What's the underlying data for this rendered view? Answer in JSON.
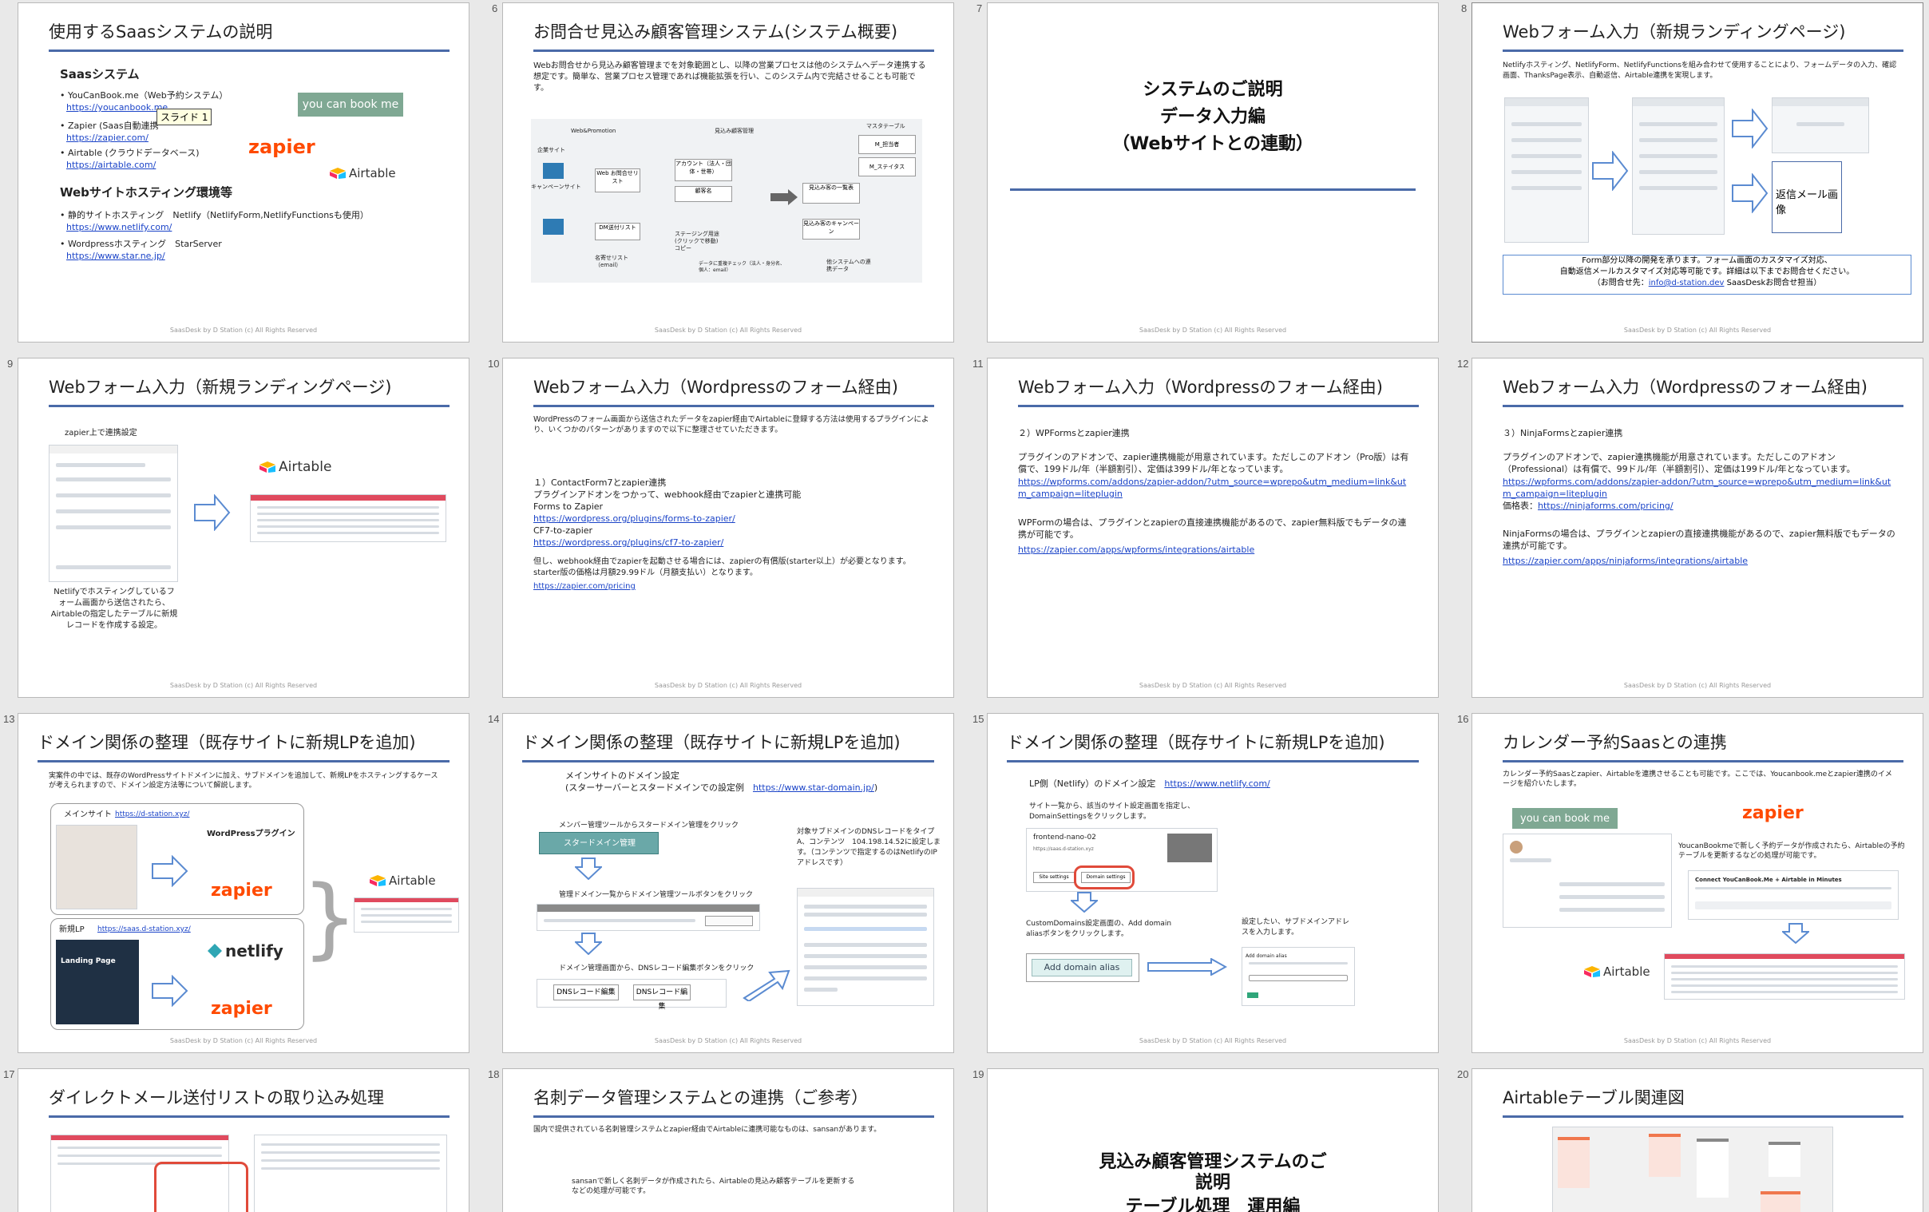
{
  "footer": "SaasDesk by D Station (c) All Rights Reserved",
  "colors": {
    "accent": "#4a6aa8",
    "zapier": "#ff4a00",
    "link": "#1b44c8"
  },
  "slides": {
    "s5": {
      "title": "使用するSaasシステムの説明",
      "h1": "Saasシステム",
      "b1": "YouCanBook.me（Web予約システム）",
      "l1": "https://youcanbook.me",
      "b2": "Zapier (Saas自動連携",
      "l2": "https://zapier.com/",
      "b3": "Airtable (クラウドデータベース)",
      "l3": "https://airtable.com/",
      "h2": "Webサイトホスティング環境等",
      "b4": "静的サイトホスティング　Netlify（NetlifyForm,NetlifyFunctionsも使用）",
      "l4": "https://www.netlify.com/",
      "b5": "Wordpressホスティング　StarServer",
      "l5": "https://www.star.ne.jp/",
      "tooltip": "スライド 1",
      "ybm": "you can book me",
      "zapier": "zapier",
      "airtable": "Airtable"
    },
    "s6": {
      "num": "6",
      "title": "お問合せ見込み顧客管理システム(システム概要)",
      "text": "Webお問合せから見込み顧客管理までを対象範囲とし、以降の営業プロセスは他のシステムへデータ連携する想定です。簡単な、営業プロセス管理であれば機能拡張を行い、このシステム内で完結させることも可能です。",
      "d_web": "Web&Promotion",
      "d_crm": "見込み顧客管理",
      "d_master": "マスタテーブル",
      "d_company": "企業サイト",
      "d_campaign": "キャンペーンサイト",
      "d_form": "Web お問合せリスト",
      "d_account": "アカウント（法人・団体・世帯）",
      "d_contact": "顧客名",
      "d_dm": "DM送付リスト",
      "d_m1": "M_担当者",
      "d_m2": "M_ステイタス",
      "d_lead": "見込み客の一覧表",
      "d_campaign2": "見込み客のキャンペーン",
      "d_list": "名寄せリスト（email）",
      "d_status": "ステージング用途(クリックで移動)コピー",
      "d_check": "データに重複チェック（法人・身分名、個人：email）",
      "d_other": "他システムへの連携データ"
    },
    "s7": {
      "num": "7",
      "line1": "システムのご説明",
      "line2": "データ入力編",
      "line3": "（Webサイトとの連動）"
    },
    "s8": {
      "num": "8",
      "title": "Webフォーム入力（新規ランディングページ)",
      "text": "Netlifyホスティング、NetlifyForm、NetlifyFunctionsを組み合わせて使用することにより、フォームデータの入力、確認画面、ThanksPage表示、自動返信、Airtable連携を実現します。",
      "reply": "返信メール画像",
      "note1": "Form部分以降の開発を承ります。フォーム画面のカスタマイズ対応、",
      "note2": "自動返信メールカスタマイズ対応等可能です。詳細は以下までお問合せください。",
      "note3_pre": "（お問合せ先：",
      "note3_link": "info@d-station.dev",
      "note3_post": " SaasDeskお問合せ担当）"
    },
    "s9": {
      "num": "9",
      "title": "Webフォーム入力（新規ランディングページ)",
      "zap": "zapier上で連携設定",
      "desc": "Netlifyでホスティングしているフォーム画面から送信されたら、Airtableの指定したテーブルに新規レコードを作成する設定。",
      "airtable": "Airtable"
    },
    "s10": {
      "num": "10",
      "title": "Webフォーム入力（Wordpressのフォーム経由)",
      "intro": "WordPressのフォーム画面から送信されたデータをzapier経由でAirtableに登録する方法は使用するプラグインにより、いくつかのパターンがありますので以下に整理させていただきます。",
      "h": "１）ContactForm7とzapier連携",
      "t1": "プラグインアドオンをつかって、webhook経由でzapierと連携可能",
      "t2": "Forms to Zapier",
      "l1": "https://wordpress.org/plugins/forms-to-zapier/",
      "t3": "CF7-to-zapier",
      "l2": "https://wordpress.org/plugins/cf7-to-zapier/",
      "t4": "但し、webhook経由でzapierを起動させる場合には、zapierの有償版(starter以上）が必要となります。starter版の価格は月額29.99ドル（月額支払い）となります。",
      "l3": "https://zapier.com/pricing"
    },
    "s11": {
      "num": "11",
      "title": "Webフォーム入力（Wordpressのフォーム経由)",
      "h": "２）WPFormsとzapier連携",
      "t1": "プラグインのアドオンで、zapier連携機能が用意されています。ただしこのアドオン（Pro版）は有償で、199ドル/年（半額割引）、定価は399ドル/年となっています。",
      "l1": "https://wpforms.com/addons/zapier-addon/?utm_source=wprepo&utm_medium=link&utm_campaign=liteplugin",
      "t2": "WPFormの場合は、プラグインとzapierの直接連携機能があるので、zapier無料版でもデータの連携が可能です。",
      "l2": "https://zapier.com/apps/wpforms/integrations/airtable"
    },
    "s12": {
      "num": "12",
      "title": "Webフォーム入力（Wordpressのフォーム経由)",
      "h": "３）NinjaFormsとzapier連携",
      "t1": "プラグインのアドオンで、zapier連携機能が用意されています。ただしこのアドオン（Professional）は有償で、99ドル/年（半額割引）、定価は199ドル/年となっています。",
      "l1": "https://wpforms.com/addons/zapier-addon/?utm_source=wprepo&utm_medium=link&utm_campaign=liteplugin",
      "price_label": "価格表：",
      "l2": "https://ninjaforms.com/pricing/",
      "t2": "NinjaFormsの場合は、プラグインとzapierの直接連携機能があるので、zapier無料版でもデータの連携が可能です。",
      "l3": "https://zapier.com/apps/ninjaforms/integrations/airtable"
    },
    "s13": {
      "num": "13",
      "title": "ドメイン関係の整理（既存サイトに新規LPを追加)",
      "intro": "実案件の中では、既存のWordPressサイトドメインに加え、サブドメインを追加して、新規LPをホスティングするケースが考えられますので、ドメイン設定方法等について解説します。",
      "main_label": "メインサイト",
      "main_url": "https://d-station.xyz/",
      "wp": "WordPressプラグイン",
      "lp_label": "新規LP",
      "lp_url": "https://saas.d-station.xyz/",
      "landing": "Landing Page",
      "zapier": "zapier",
      "netlify": "netlify",
      "airtable": "Airtable"
    },
    "s14": {
      "num": "14",
      "title": "ドメイン関係の整理（既存サイトに新規LPを追加)",
      "h1": "メインサイトのドメイン設定",
      "h2_pre": "(スターサーバーとスタードメインでの設定例　",
      "h2_link": "https://www.star-domain.jp/",
      "h2_post": ")",
      "step1": "メンバー管理ツールからスタードメイン管理をクリック",
      "step1_btn": "スタードメイン管理",
      "step2": "管理ドメイン一覧からドメイン管理ツールボタンをクリック",
      "step3": "ドメイン管理画面から、DNSレコード編集ボタンをクリック",
      "btn_dns1": "DNSレコード編集",
      "btn_dns2": "DNSレコード編集",
      "side": "対象サブドメインのDNSレコードをタイプA、コンテンツ　104.198.14.52に設定します。（コンテンツで指定するのはNetlifyのIPアドレスです）"
    },
    "s15": {
      "num": "15",
      "title": "ドメイン関係の整理（既存サイトに新規LPを追加)",
      "h_pre": "LP側（Netlify）のドメイン設定　",
      "h_link": "https://www.netlify.com/",
      "t1": "サイト一覧から、該当のサイト設定画面を指定し、DomainSettingsをクリックします。",
      "site": "frontend-nano-02",
      "site_url": "https://saas.d-station.xyz",
      "btn1": "Site settings",
      "btn2": "Domain settings",
      "t2": "CustomDomains設定画面の、Add domain aliasボタンをクリックします。",
      "add_alias": "Add domain alias",
      "t3": "設定したい、サブドメインアドレスを入力します。",
      "form_title": "Add domain alias"
    },
    "s16": {
      "num": "16",
      "title": "カレンダー予約Saasとの連携",
      "intro": "カレンダー予約Saasとzapier、Airtableを連携させることも可能です。ここでは、Youcanbook.meとzapier連携のイメージを紹介いたします。",
      "ybm": "you can book me",
      "zapier": "zapier",
      "desc": "YoucanBookmeで新しく予約データが作成されたら、Airtableの予約テーブルを更新するなどの処理が可能です。",
      "connect": "Connect YouCanBook.Me + Airtable in Minutes",
      "airtable": "Airtable"
    },
    "s17": {
      "num": "17",
      "title": "ダイレクトメール送付リストの取り込み処理"
    },
    "s18": {
      "num": "18",
      "title": "名刺データ管理システムとの連携（ご参考）",
      "t1": "国内で提供されている名刺管理システムとzapier経由でAirtableに連携可能なものは、sansanがあります。",
      "t2": "sansanで新しく名刺データが作成されたら、Airtableの見込み顧客テーブルを更新するなどの処理が可能です。"
    },
    "s19": {
      "num": "19",
      "line1": "見込み顧客管理システムのご",
      "line2": "説明",
      "line3": "テーブル処理　運用編"
    },
    "s20": {
      "num": "20",
      "title": "Airtableテーブル関連図"
    }
  }
}
